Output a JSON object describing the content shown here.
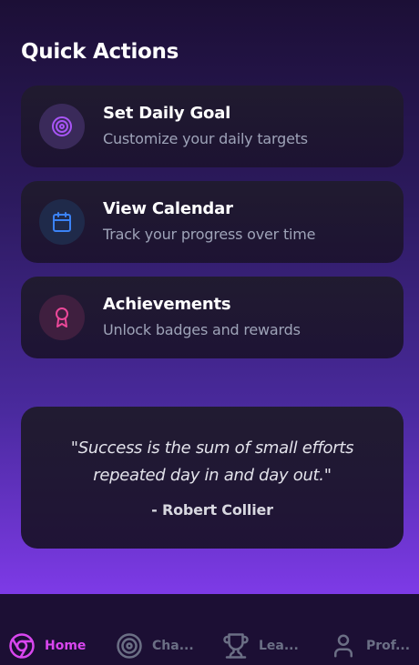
{
  "quick_actions": {
    "title": "Quick Actions",
    "cards": [
      {
        "title": "Set Daily Goal",
        "subtitle": "Customize your daily targets",
        "icon": "target-icon",
        "color": "#a855f7",
        "bg": "#3a2a5a"
      },
      {
        "title": "View Calendar",
        "subtitle": "Track your progress over time",
        "icon": "calendar-icon",
        "color": "#3b82f6",
        "bg": "#1f2a4a"
      },
      {
        "title": "Achievements",
        "subtitle": "Unlock badges and rewards",
        "icon": "award-icon",
        "color": "#ec4899",
        "bg": "#3f1f3f"
      }
    ]
  },
  "quote": {
    "text": "\"Success is the sum of small efforts repeated day in and day out.\"",
    "author": "- Robert Collier"
  },
  "nav": {
    "items": [
      {
        "label": "Home",
        "icon": "chrome-icon",
        "active": true
      },
      {
        "label": "Cha...",
        "icon": "target-icon",
        "active": false
      },
      {
        "label": "Lea...",
        "icon": "trophy-icon",
        "active": false
      },
      {
        "label": "Prof...",
        "icon": "user-icon",
        "active": false
      }
    ],
    "active_color": "#d946ef",
    "inactive_color": "#6b6f85"
  }
}
